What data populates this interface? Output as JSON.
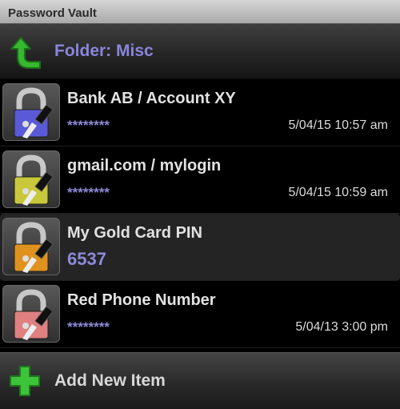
{
  "app": {
    "title": "Password Vault"
  },
  "folder": {
    "label": "Folder: Misc",
    "icon": "green-up-arrow"
  },
  "items": [
    {
      "title": "Bank AB / Account XY",
      "secret": "********",
      "timestamp": "5/04/15 10:57 am",
      "lock_color": "#5a5ad8"
    },
    {
      "title": "gmail.com / mylogin",
      "secret": "********",
      "timestamp": "5/04/15 10:59 am",
      "lock_color": "#c8c83a"
    },
    {
      "title": "My Gold Card PIN",
      "secret": "6537",
      "timestamp": "",
      "lock_color": "#e0921e"
    },
    {
      "title": "Red Phone Number",
      "secret": "********",
      "timestamp": "5/04/13 3:00 pm",
      "lock_color": "#e08080"
    }
  ],
  "footer": {
    "add_label": "Add New Item",
    "icon": "green-plus"
  },
  "colors": {
    "accent": "#8a85dc",
    "background": "#000000"
  }
}
